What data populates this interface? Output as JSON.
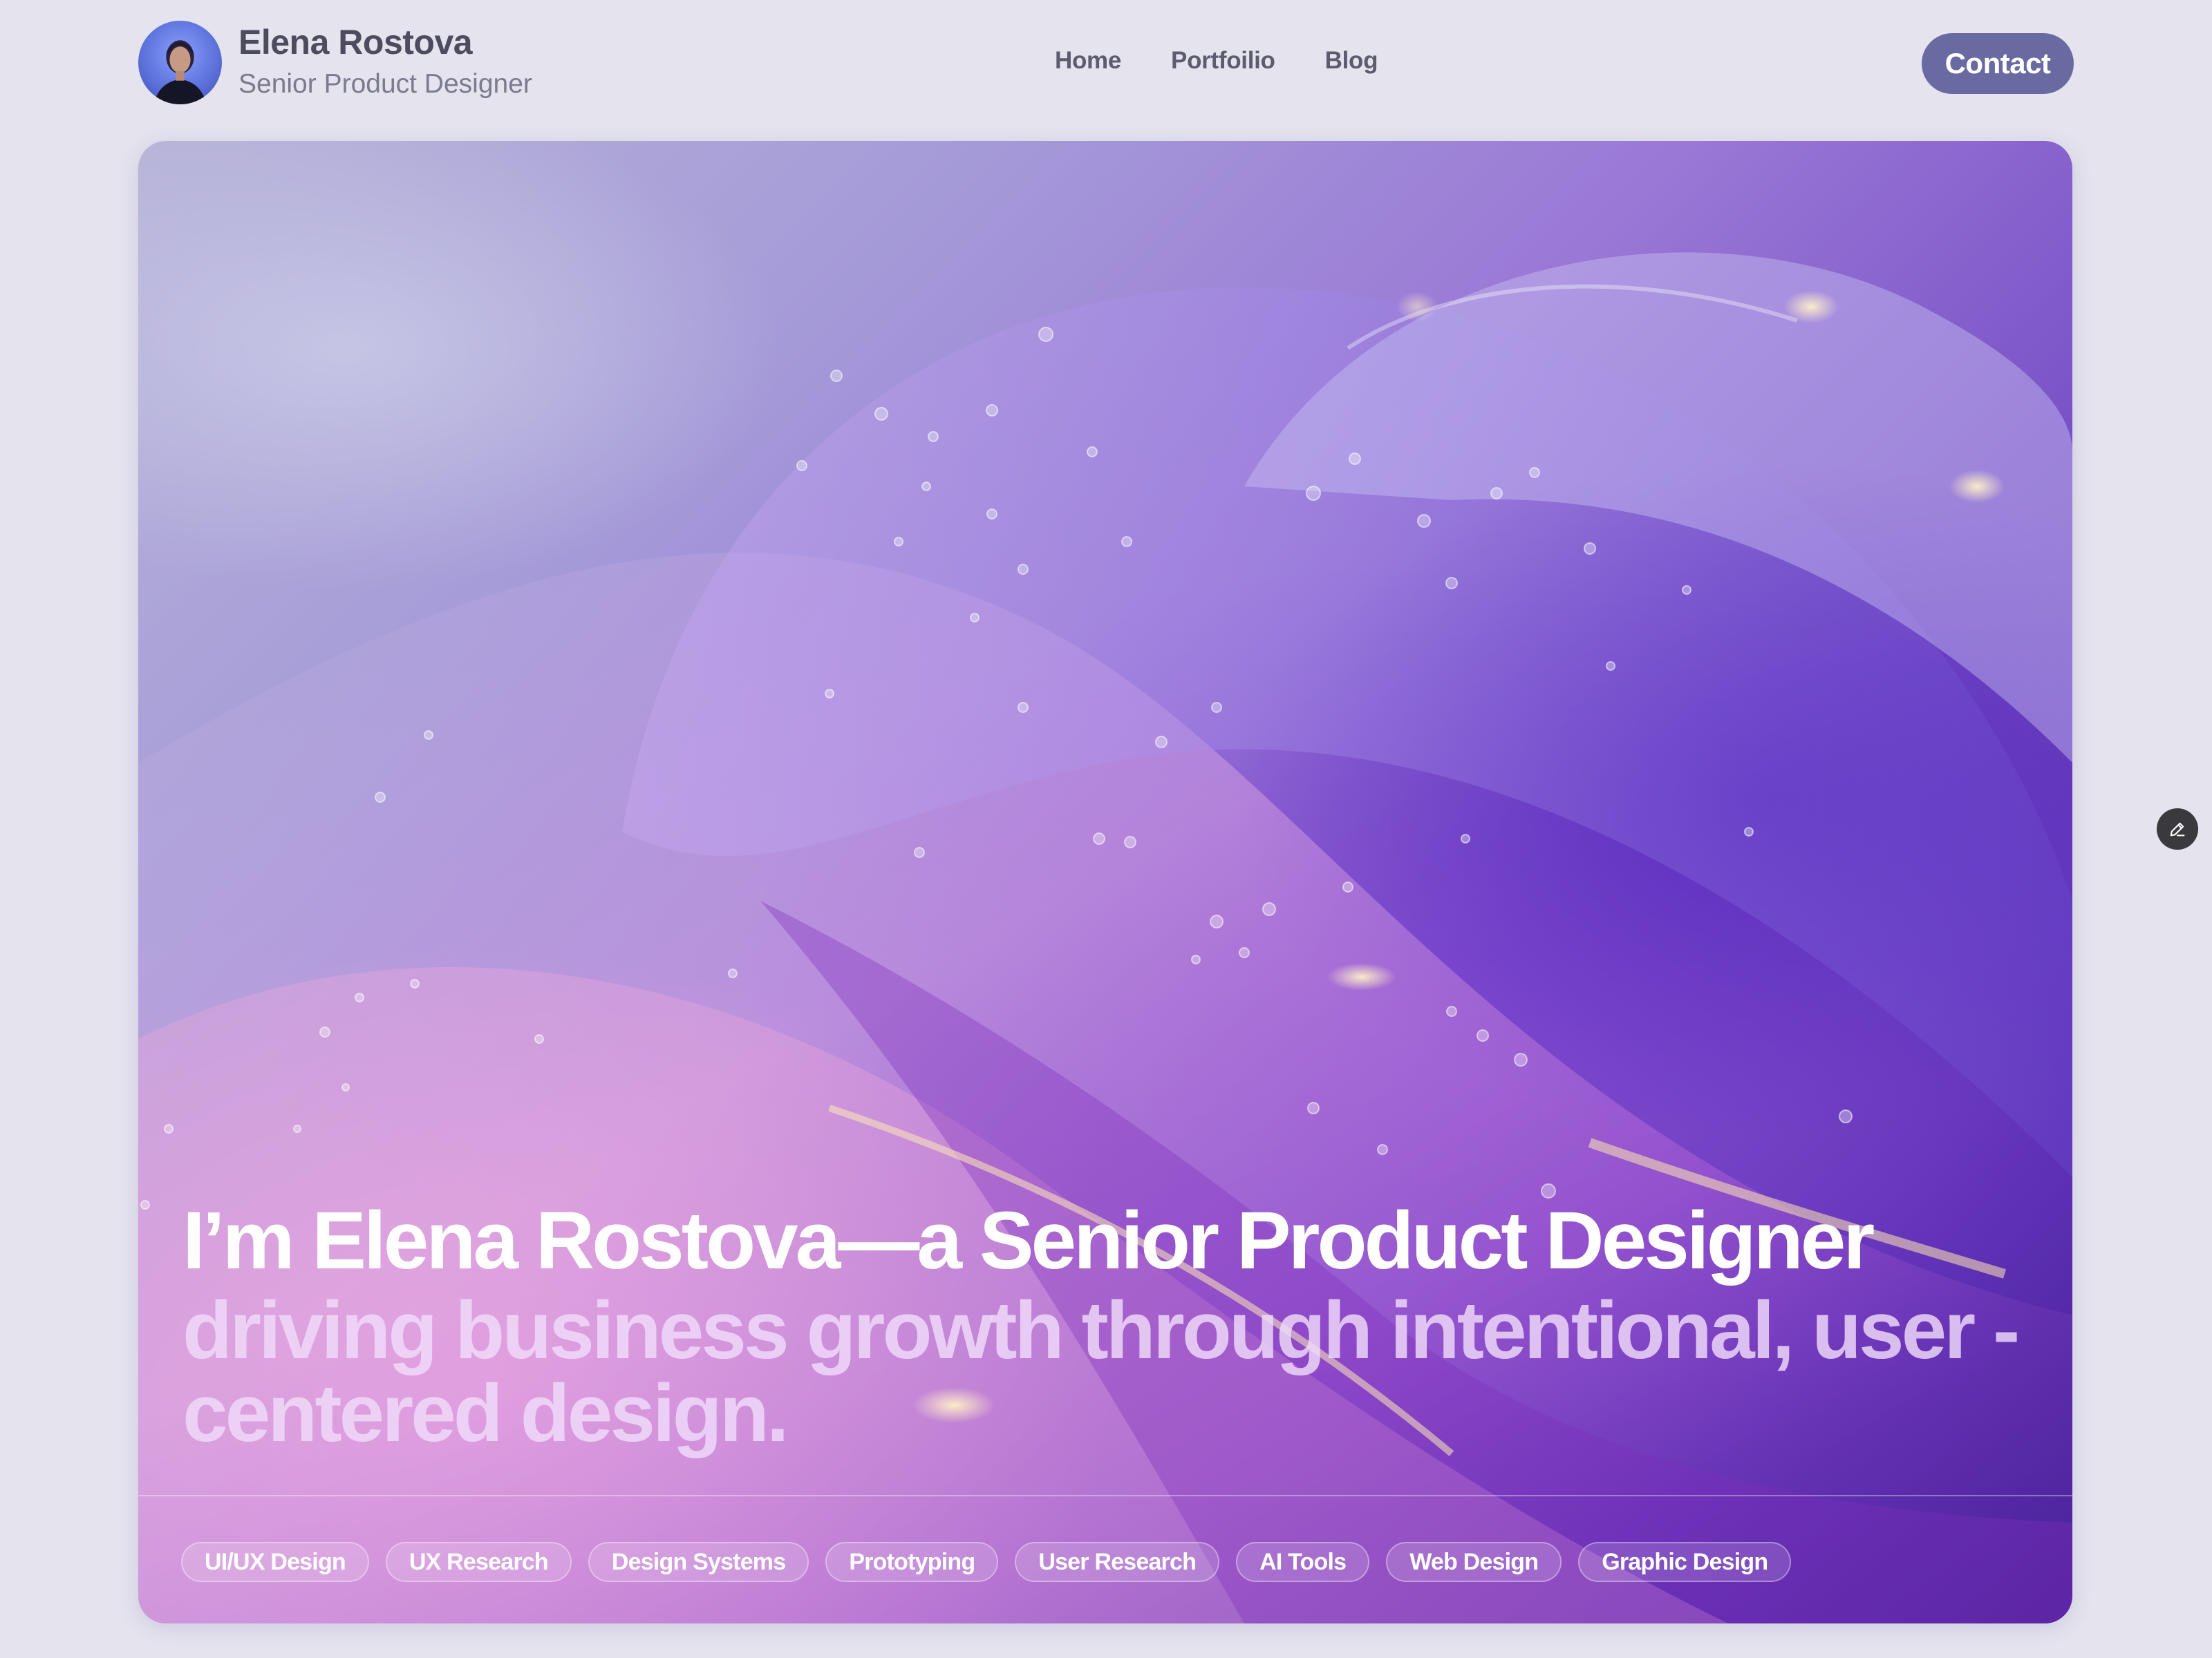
{
  "header": {
    "name": "Elena Rostova",
    "role": "Senior Product Designer",
    "avatar_icon": "avatar-portrait",
    "nav": [
      {
        "label": "Home"
      },
      {
        "label": "Portfoilio"
      },
      {
        "label": "Blog"
      }
    ],
    "contact_label": "Contact"
  },
  "hero": {
    "headline_primary": "I’m Elena Rostova—a Senior Product Designer",
    "headline_secondary": "driving business growth through intentional, user -centered design.",
    "tags": [
      {
        "label": "UI/UX Design"
      },
      {
        "label": "UX Research"
      },
      {
        "label": "Design Systems"
      },
      {
        "label": "Prototyping"
      },
      {
        "label": "User Research"
      },
      {
        "label": "AI Tools"
      },
      {
        "label": "Web Design"
      },
      {
        "label": "Graphic Design"
      }
    ]
  },
  "floating": {
    "edit_icon": "pencil-icon"
  },
  "colors": {
    "background": "#e4e3ee",
    "contact_button": "#6a6aa3",
    "hero_purple": "#5c2fb4",
    "hero_lilac": "#b7b4d8"
  }
}
